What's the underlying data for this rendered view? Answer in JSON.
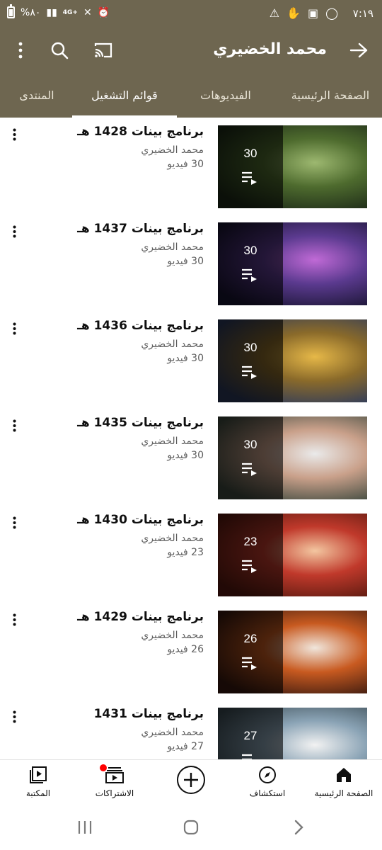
{
  "status_bar": {
    "time": "٧:١٩",
    "battery": "%٨٠",
    "network": "4G+"
  },
  "header": {
    "channel_name": "محمد الخضيري",
    "icons": [
      "back-arrow-icon",
      "cast-icon",
      "search-icon",
      "more-vert-icon"
    ]
  },
  "tabs": [
    {
      "label": "الصفحة الرئيسية",
      "active": false
    },
    {
      "label": "الفيديوهات",
      "active": false
    },
    {
      "label": "قوائم التشغيل",
      "active": true
    },
    {
      "label": "المنتدى",
      "active": false
    }
  ],
  "playlists": [
    {
      "title": "برنامج بينات 1428 هـ",
      "channel": "محمد الخضيري",
      "videos_label": "30 فيديو",
      "count": "30",
      "theme": [
        "#1d2a18",
        "#4e6b2e",
        "#9db870"
      ]
    },
    {
      "title": "برنامج بينات 1437 هـ",
      "channel": "محمد الخضيري",
      "videos_label": "30 فيديو",
      "count": "30",
      "theme": [
        "#1a1533",
        "#5b3a8f",
        "#c06ad6"
      ]
    },
    {
      "title": "برنامج بينات 1436 هـ",
      "channel": "محمد الخضيري",
      "videos_label": "30 فيديو",
      "count": "30",
      "theme": [
        "#2d3a5c",
        "#8a6a2a",
        "#e6b848"
      ]
    },
    {
      "title": "برنامج بينات 1435 هـ",
      "channel": "محمد الخضيري",
      "videos_label": "30 فيديو",
      "count": "30",
      "theme": [
        "#3f4a3f",
        "#c9a08a",
        "#eaeaea"
      ]
    },
    {
      "title": "برنامج بينات 1430 هـ",
      "channel": "محمد الخضيري",
      "videos_label": "23 فيديو",
      "count": "23",
      "theme": [
        "#5a1a10",
        "#c0392b",
        "#f3c6a0"
      ]
    },
    {
      "title": "برنامج بينات 1429 هـ",
      "channel": "محمد الخضيري",
      "videos_label": "26 فيديو",
      "count": "26",
      "theme": [
        "#3a1a10",
        "#c85a20",
        "#f0e6dc"
      ]
    },
    {
      "title": "برنامج بينات 1431",
      "channel": "محمد الخضيري",
      "videos_label": "27 فيديو",
      "count": "27",
      "theme": [
        "#3a4a52",
        "#8aa3b5",
        "#f2f2f2"
      ]
    }
  ],
  "bottom_nav": {
    "home": "الصفحة الرئيسية",
    "explore": "استكشاف",
    "create": "",
    "subscriptions": "الاشتراكات",
    "library": "المكتبة"
  },
  "colors": {
    "header_bg": "#6e6650",
    "notification_dot": "#ff0000"
  }
}
